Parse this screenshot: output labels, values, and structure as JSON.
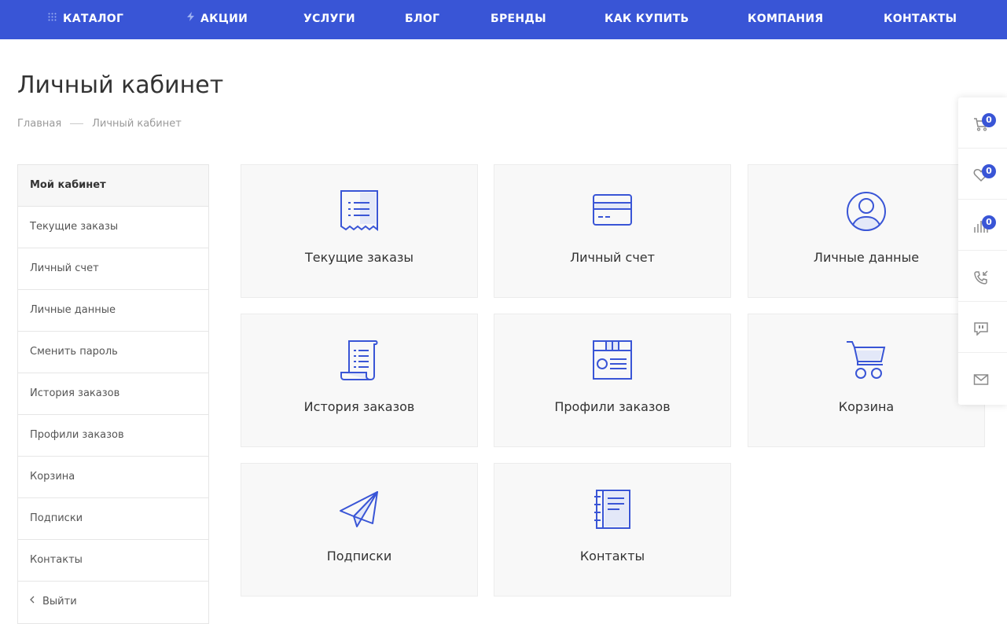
{
  "nav": {
    "items": [
      {
        "label": "КАТАЛОГ",
        "icon": "grid-dots-icon"
      },
      {
        "label": "АКЦИИ",
        "icon": "lightning-icon"
      },
      {
        "label": "УСЛУГИ"
      },
      {
        "label": "БЛОГ"
      },
      {
        "label": "БРЕНДЫ"
      },
      {
        "label": "КАК КУПИТЬ"
      },
      {
        "label": "КОМПАНИЯ"
      },
      {
        "label": "КОНТАКТЫ"
      }
    ]
  },
  "page": {
    "title": "Личный кабинет",
    "breadcrumb": [
      "Главная",
      "Личный кабинет"
    ]
  },
  "sidebar": {
    "items": [
      "Мой кабинет",
      "Текущие заказы",
      "Личный счет",
      "Личные данные",
      "Сменить пароль",
      "История заказов",
      "Профили заказов",
      "Корзина",
      "Подписки",
      "Контакты",
      "Выйти"
    ]
  },
  "tiles": [
    {
      "label": "Текущие заказы",
      "icon": "receipt-icon"
    },
    {
      "label": "Личный счет",
      "icon": "credit-card-icon"
    },
    {
      "label": "Личные данные",
      "icon": "user-circle-icon"
    },
    {
      "label": "История заказов",
      "icon": "scroll-list-icon"
    },
    {
      "label": "Профили заказов",
      "icon": "profile-box-icon"
    },
    {
      "label": "Корзина",
      "icon": "cart-icon"
    },
    {
      "label": "Подписки",
      "icon": "paper-plane-icon"
    },
    {
      "label": "Контакты",
      "icon": "notebook-icon"
    }
  ],
  "float_panel": {
    "cart_count": "0",
    "favorites_count": "0",
    "compare_count": "0"
  },
  "colors": {
    "accent": "#3955d6",
    "tile_bg": "#f8f8f8",
    "border": "#e6e6e6"
  }
}
